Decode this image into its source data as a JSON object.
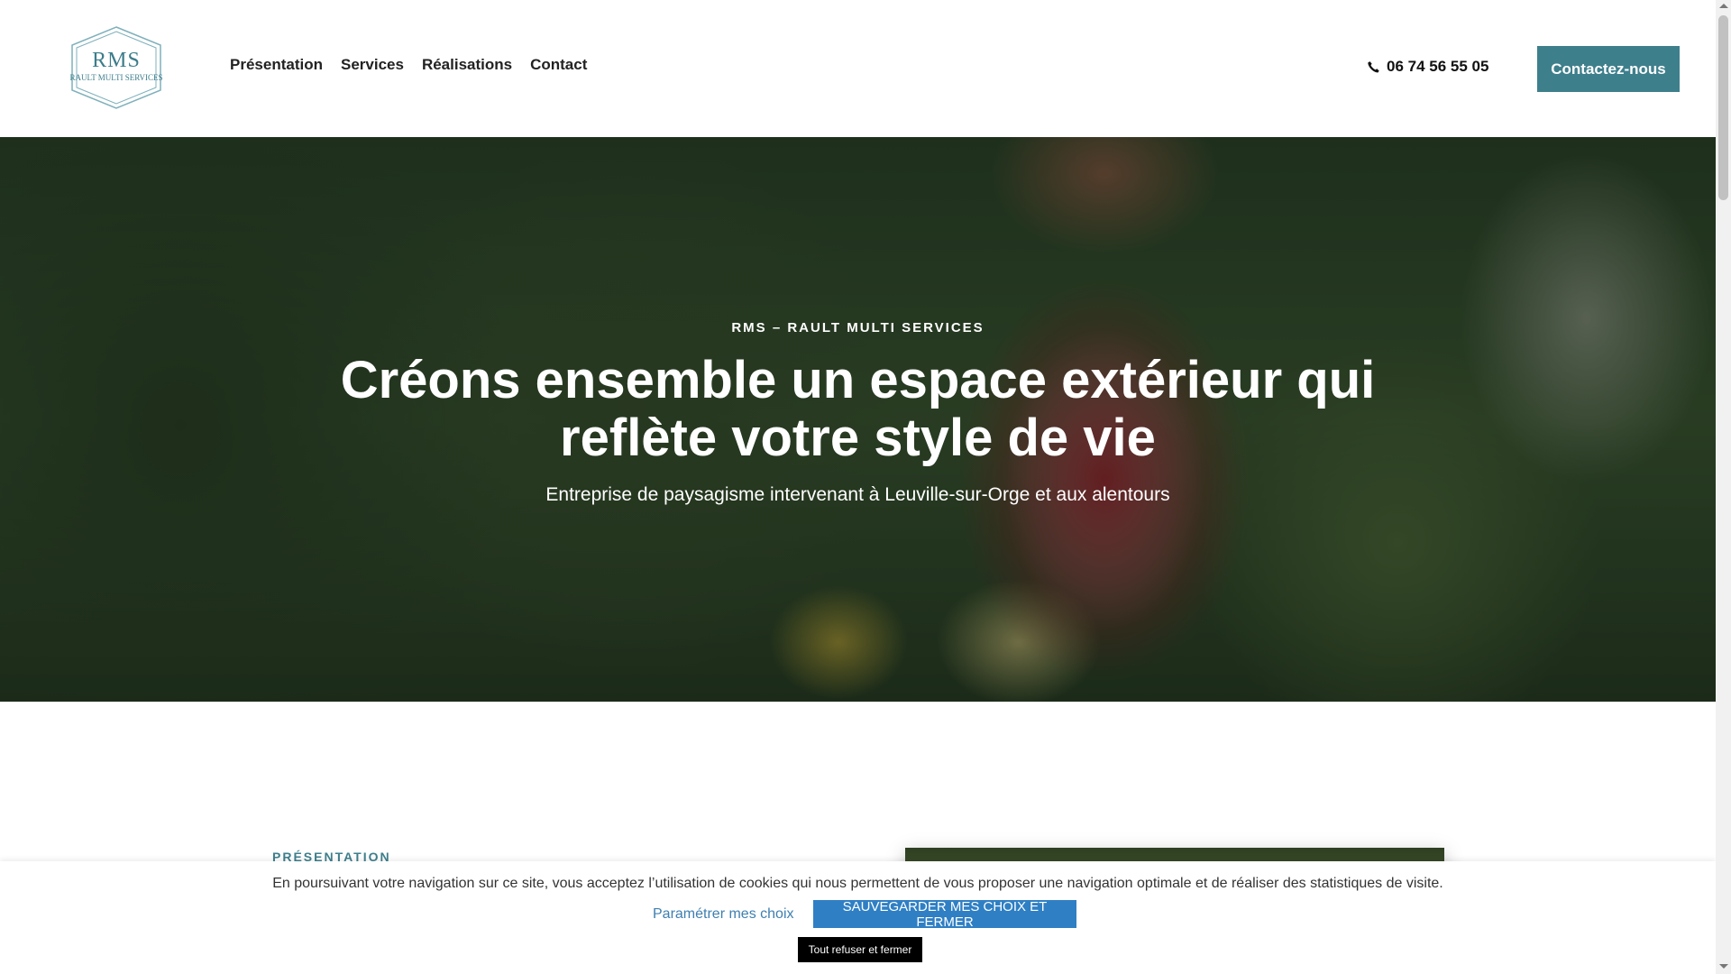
{
  "header": {
    "logo": {
      "title": "RMS",
      "subtitle": "RAULT MULTI SERVICES"
    },
    "nav": [
      {
        "label": "Présentation"
      },
      {
        "label": "Services"
      },
      {
        "label": "Réalisations"
      },
      {
        "label": "Contact"
      }
    ],
    "phone": "06 74 56 55 05",
    "cta_label": "Contactez-nous"
  },
  "hero": {
    "kicker": "RMS – RAULT MULTI SERVICES",
    "title": "Créons ensemble un espace extérieur qui reflète votre style de vie",
    "subtitle": "Entreprise de paysagisme intervenant à Leuville-sur-Orge et aux alentours"
  },
  "section": {
    "label": "PRÉSENTATION"
  },
  "cookie": {
    "text": "En poursuivant votre navigation sur ce site, vous acceptez l’utilisation de cookies qui nous permettent de vous proposer une navigation optimale et de réaliser des statistiques de visite.",
    "params_label": "Paramétrer mes choix",
    "save_label": "SAUVEGARDER MES CHOIX ET FERMER",
    "refuse_label": "Tout refuser et fermer"
  },
  "colors": {
    "accent": "#3e7f8c",
    "cookie_button": "#2f7fc4",
    "link": "#3e7fb0"
  },
  "icons": {
    "phone": "phone-icon"
  }
}
